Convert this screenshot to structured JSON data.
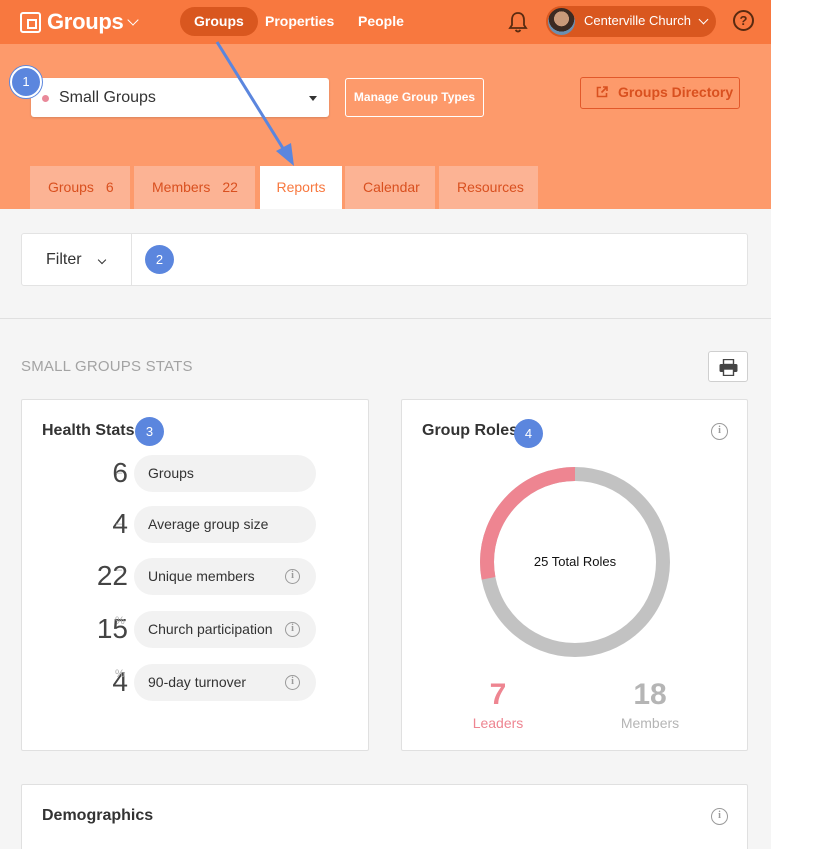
{
  "topnav": {
    "brand": "Groups",
    "links": [
      "Groups",
      "Properties",
      "People"
    ],
    "church": "Centerville Church",
    "help": "?"
  },
  "header": {
    "group_type": "Small Groups",
    "manage_label": "Manage Group Types",
    "directory_label": "Groups Directory",
    "tabs": [
      {
        "label": "Groups",
        "count": "6"
      },
      {
        "label": "Members",
        "count": "22"
      },
      {
        "label": "Reports"
      },
      {
        "label": "Calendar"
      },
      {
        "label": "Resources"
      }
    ]
  },
  "filter": {
    "label": "Filter"
  },
  "markers": [
    "1",
    "2",
    "3",
    "4"
  ],
  "stats_title": "SMALL GROUPS STATS",
  "health": {
    "title": "Health Stats",
    "rows": [
      {
        "value": "6",
        "unit": "–",
        "label": "Groups"
      },
      {
        "value": "4",
        "unit": "–",
        "label": "Average group size"
      },
      {
        "value": "22",
        "unit": "–",
        "label": "Unique members"
      },
      {
        "value": "15",
        "unit": "%",
        "label": "Church participation"
      },
      {
        "value": "4",
        "unit": "%",
        "label": "90-day turnover"
      }
    ]
  },
  "roles": {
    "title": "Group Roles",
    "center_text": "25 Total Roles",
    "leaders_value": "7",
    "leaders_label": "Leaders",
    "members_value": "18",
    "members_label": "Members",
    "leader_fraction": 0.28
  },
  "demographics": {
    "title": "Demographics"
  },
  "colors": {
    "nav": "#f8783f",
    "header": "#fd9a6b",
    "leaders": "#ee8591",
    "members": "#c2c2c2",
    "badge": "#5b86de"
  }
}
